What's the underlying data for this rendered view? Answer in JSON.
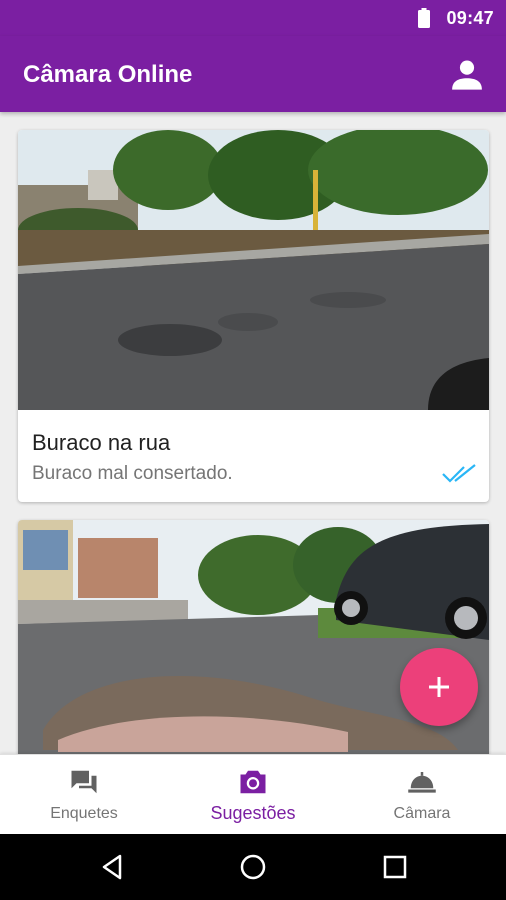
{
  "status_bar": {
    "time": "09:47",
    "battery_icon": "battery-full-icon"
  },
  "app_bar": {
    "title": "Câmara Online",
    "account_icon": "account-icon"
  },
  "feed": {
    "cards": [
      {
        "title": "Buraco na rua",
        "description": "Buraco mal consertado.",
        "status_icon": "double-check-icon"
      },
      {
        "title": "",
        "description": ""
      }
    ]
  },
  "fab": {
    "label": "+",
    "icon": "add-icon"
  },
  "bottom_nav": {
    "items": [
      {
        "label": "Enquetes",
        "icon": "forum-icon",
        "active": false
      },
      {
        "label": "Sugestões",
        "icon": "camera-icon",
        "active": true
      },
      {
        "label": "Câmara",
        "icon": "bell-dome-icon",
        "active": false
      }
    ]
  },
  "android_nav": {
    "icons": [
      "back-icon",
      "home-icon",
      "recents-icon"
    ]
  },
  "colors": {
    "primary": "#7b1fa2",
    "accent": "#ec407a",
    "seen": "#29b6f6",
    "text_secondary": "#757575"
  }
}
